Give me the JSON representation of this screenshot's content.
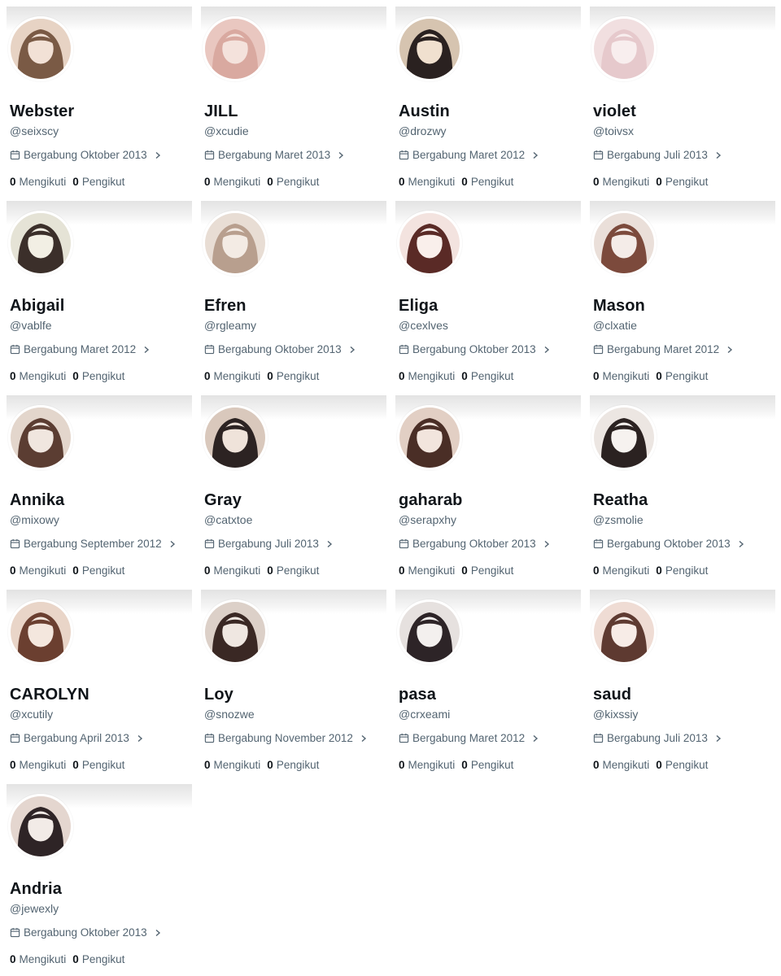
{
  "profiles": [
    {
      "name": "Webster",
      "handle": "@seixscy",
      "joined": "Bergabung Oktober 2013",
      "following_count": "0",
      "following_label": "Mengikuti",
      "followers_count": "0",
      "followers_label": "Pengikut",
      "avatar_colors": [
        "#e7d3c4",
        "#7a5a45",
        "#f2e1d6"
      ]
    },
    {
      "name": "JILL",
      "handle": "@xcudie",
      "joined": "Bergabung Maret 2013",
      "following_count": "0",
      "following_label": "Mengikuti",
      "followers_count": "0",
      "followers_label": "Pengikut",
      "avatar_colors": [
        "#e9c7c0",
        "#d9a9a0",
        "#f4e2dc"
      ]
    },
    {
      "name": "Austin",
      "handle": "@drozwy",
      "joined": "Bergabung Maret 2012",
      "following_count": "0",
      "following_label": "Mengikuti",
      "followers_count": "0",
      "followers_label": "Pengikut",
      "avatar_colors": [
        "#d6c4b0",
        "#2a2120",
        "#f0e0cf"
      ]
    },
    {
      "name": "violet",
      "handle": "@toivsx",
      "joined": "Bergabung Juli 2013",
      "following_count": "0",
      "following_label": "Mengikuti",
      "followers_count": "0",
      "followers_label": "Pengikut",
      "avatar_colors": [
        "#f1dfe0",
        "#e6c9cc",
        "#f8eeee"
      ]
    },
    {
      "name": "Abigail",
      "handle": "@vablfe",
      "joined": "Bergabung Maret 2012",
      "following_count": "0",
      "following_label": "Mengikuti",
      "followers_count": "0",
      "followers_label": "Pengikut",
      "avatar_colors": [
        "#e5e3d6",
        "#3b2f2a",
        "#f2efe4"
      ]
    },
    {
      "name": "Efren",
      "handle": "@rgleamy",
      "joined": "Bergabung Oktober 2013",
      "following_count": "0",
      "following_label": "Mengikuti",
      "followers_count": "0",
      "followers_label": "Pengikut",
      "avatar_colors": [
        "#e8ddd4",
        "#b89f8e",
        "#f3ebe4"
      ]
    },
    {
      "name": "Eliga",
      "handle": "@cexlves",
      "joined": "Bergabung Oktober 2013",
      "following_count": "0",
      "following_label": "Mengikuti",
      "followers_count": "0",
      "followers_label": "Pengikut",
      "avatar_colors": [
        "#f3e3df",
        "#5a2a26",
        "#f9efeb"
      ]
    },
    {
      "name": "Mason",
      "handle": "@clxatie",
      "joined": "Bergabung Maret 2012",
      "following_count": "0",
      "following_label": "Mengikuti",
      "followers_count": "0",
      "followers_label": "Pengikut",
      "avatar_colors": [
        "#eadfd9",
        "#7c4a3c",
        "#f4ece8"
      ]
    },
    {
      "name": "Annika",
      "handle": "@mixowy",
      "joined": "Bergabung September 2012",
      "following_count": "0",
      "following_label": "Mengikuti",
      "followers_count": "0",
      "followers_label": "Pengikut",
      "avatar_colors": [
        "#e3d6cc",
        "#5b3d32",
        "#f0e6df"
      ]
    },
    {
      "name": "Gray",
      "handle": "@catxtoe",
      "joined": "Bergabung Juli 2013",
      "following_count": "0",
      "following_label": "Mengikuti",
      "followers_count": "0",
      "followers_label": "Pengikut",
      "avatar_colors": [
        "#d9c8bc",
        "#2c2322",
        "#efe3da"
      ]
    },
    {
      "name": "gaharab",
      "handle": "@serapxhy",
      "joined": "Bergabung Oktober 2013",
      "following_count": "0",
      "following_label": "Mengikuti",
      "followers_count": "0",
      "followers_label": "Pengikut",
      "avatar_colors": [
        "#e2cfc4",
        "#4a2e26",
        "#f2e5dd"
      ]
    },
    {
      "name": "Reatha",
      "handle": "@zsmolie",
      "joined": "Bergabung Oktober 2013",
      "following_count": "0",
      "following_label": "Mengikuti",
      "followers_count": "0",
      "followers_label": "Pengikut",
      "avatar_colors": [
        "#ece6e2",
        "#2b2221",
        "#f6f2ef"
      ]
    },
    {
      "name": "CAROLYN",
      "handle": "@xcutily",
      "joined": "Bergabung April 2013",
      "following_count": "0",
      "following_label": "Mengikuti",
      "followers_count": "0",
      "followers_label": "Pengikut",
      "avatar_colors": [
        "#e9d5c8",
        "#6b3f30",
        "#f4e7de"
      ]
    },
    {
      "name": "Loy",
      "handle": "@snozwe",
      "joined": "Bergabung November 2012",
      "following_count": "0",
      "following_label": "Mengikuti",
      "followers_count": "0",
      "followers_label": "Pengikut",
      "avatar_colors": [
        "#dcd0c8",
        "#3a2824",
        "#efe7e1"
      ]
    },
    {
      "name": "pasa",
      "handle": "@crxeami",
      "joined": "Bergabung Maret 2012",
      "following_count": "0",
      "following_label": "Mengikuti",
      "followers_count": "0",
      "followers_label": "Pengikut",
      "avatar_colors": [
        "#e6e1df",
        "#2d2427",
        "#f3f0ee"
      ]
    },
    {
      "name": "saud",
      "handle": "@kixssiy",
      "joined": "Bergabung Juli 2013",
      "following_count": "0",
      "following_label": "Mengikuti",
      "followers_count": "0",
      "followers_label": "Pengikut",
      "avatar_colors": [
        "#efdcd4",
        "#5e3a31",
        "#f7ece7"
      ]
    },
    {
      "name": "Andria",
      "handle": "@jewexly",
      "joined": "Bergabung Oktober 2013",
      "following_count": "0",
      "following_label": "Mengikuti",
      "followers_count": "0",
      "followers_label": "Pengikut",
      "avatar_colors": [
        "#e4d6cf",
        "#2e2426",
        "#f2ebe7"
      ]
    }
  ],
  "colors": {
    "text_primary": "#0f1419",
    "text_secondary": "#536471",
    "banner": "#e8e8e8",
    "background": "#ffffff"
  },
  "icons": {
    "calendar": "calendar-icon",
    "chevron": "chevron-right-icon"
  }
}
